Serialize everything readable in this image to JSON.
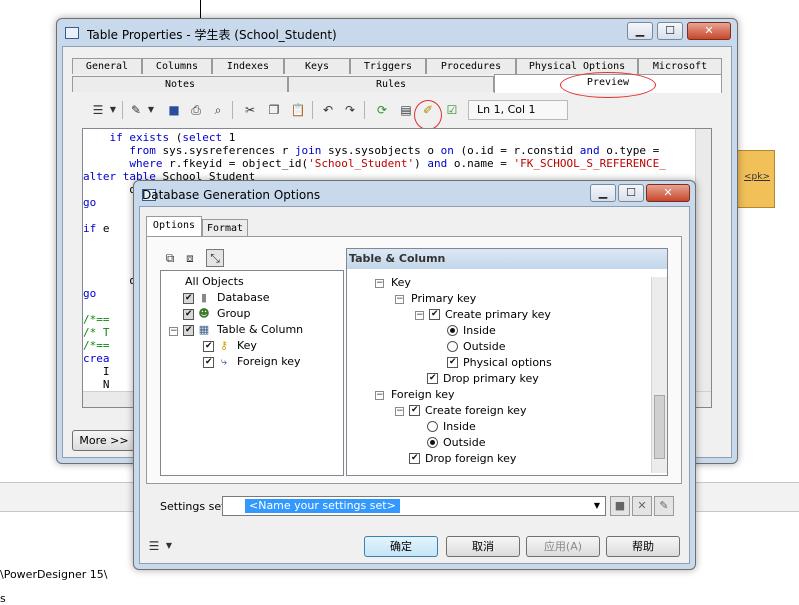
{
  "background": {
    "path_text": "\\PowerDesigner 15\\",
    "trailing_text": "s",
    "pk_label": "<pk>"
  },
  "table_props": {
    "title": "Table Properties - 学生表 (School_Student)",
    "tabs_top": [
      "General",
      "Columns",
      "Indexes",
      "Keys",
      "Triggers",
      "Procedures",
      "Physical Options",
      "Microsoft"
    ],
    "tabs_bottom": [
      "Notes",
      "Rules",
      "Preview"
    ],
    "active_tab": "Preview",
    "cursor_pos": "Ln 1, Col 1",
    "more_button": "More >>",
    "code": [
      "if exists (select 1",
      "   from sys.sysreferences r join sys.sysobjects o on (o.id = r.constid and o.type =",
      "   where r.fkeyid = object_id('School_Student') and o.name = 'FK_SCHOOL_S_REFERENCE_",
      "alter table School_Student",
      "   d",
      "go",
      "",
      "if e",
      "",
      "",
      "",
      "   d",
      "go",
      "",
      "/*==",
      "/* T",
      "/*==",
      "crea",
      "   I",
      "   N"
    ]
  },
  "dgo": {
    "title": "Database Generation Options",
    "tabs": [
      "Options",
      "Format"
    ],
    "active_tab": "Options",
    "section_header": "Table & Column",
    "tree": {
      "all_objects": "All Objects",
      "items": [
        "Database",
        "Group",
        "Table & Column",
        "Key",
        "Foreign key"
      ]
    },
    "options": {
      "key": "Key",
      "primary_key": "Primary key",
      "create_primary_key": "Create primary key",
      "inside": "Inside",
      "outside": "Outside",
      "physical_options": "Physical options",
      "drop_primary_key": "Drop primary key",
      "foreign_key": "Foreign key",
      "create_foreign_key": "Create foreign key",
      "fk_inside": "Inside",
      "fk_outside": "Outside",
      "drop_foreign_key": "Drop foreign key"
    },
    "settings_label": "Settings set:",
    "settings_value": "<Name your settings set>",
    "buttons": {
      "ok": "确定",
      "cancel": "取消",
      "apply": "应用(A)",
      "help": "帮助"
    }
  }
}
